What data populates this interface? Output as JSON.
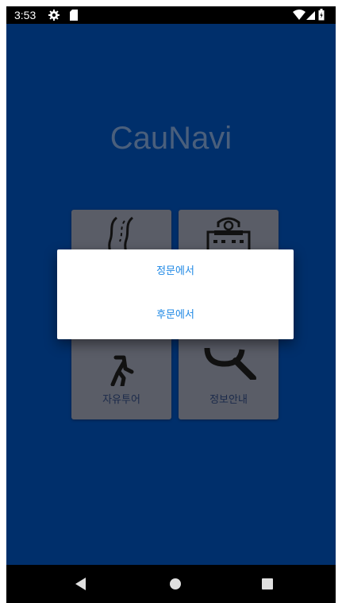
{
  "status_bar": {
    "time": "3:53",
    "left_icons": [
      "gear-icon",
      "sd-card-icon"
    ],
    "right_icons": [
      "wifi-icon",
      "signal-icon",
      "battery-icon"
    ]
  },
  "app": {
    "title": "CauNavi",
    "background_color": "#002f6b",
    "tiles": [
      {
        "icon": "road-icon",
        "label": ""
      },
      {
        "icon": "building-icon",
        "label": ""
      },
      {
        "icon": "walking-person-icon",
        "label": "자유투어"
      },
      {
        "icon": "magnifier-icon",
        "label": "정보안내"
      }
    ]
  },
  "dialog": {
    "options": [
      "정문에서",
      "후문에서"
    ],
    "accent_color": "#1e88e5"
  },
  "nav_bar": {
    "buttons": [
      "back-icon",
      "home-icon",
      "recents-icon"
    ]
  }
}
